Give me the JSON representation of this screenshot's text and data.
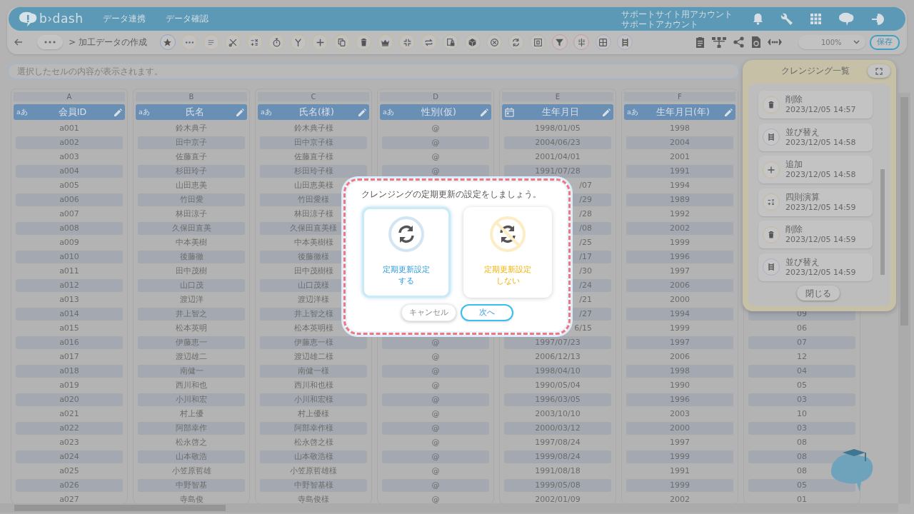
{
  "header": {
    "logo": "b›dash",
    "nav": [
      {
        "label": "データ連携"
      },
      {
        "label": "データ確認"
      }
    ],
    "account": [
      "サポートサイト用アカウント",
      "サポートアカウント"
    ]
  },
  "toolbar": {
    "breadcrumb": "> 加工データの作成",
    "tools": [
      {
        "kind": "star",
        "color": "#8ea6bd"
      },
      {
        "kind": "dots",
        "color": "#c6bb95"
      },
      {
        "kind": "lines",
        "color": "#c6bb95"
      },
      {
        "kind": "scissors",
        "color": "#c6bb95"
      },
      {
        "kind": "math",
        "color": "#c6bb95"
      },
      {
        "kind": "stopwatch",
        "color": "#c6bb95"
      },
      {
        "kind": "branch",
        "color": "#c6bb95"
      },
      {
        "kind": "plus",
        "color": "#c6bb95"
      },
      {
        "kind": "copy",
        "color": "#c6bb95"
      },
      {
        "kind": "trash",
        "color": "#c6bb95"
      },
      {
        "kind": "crown",
        "color": "#c6bb95"
      },
      {
        "kind": "compress",
        "color": "#c6bb95"
      },
      {
        "kind": "swap",
        "color": "#c6bb95"
      },
      {
        "kind": "lock",
        "color": "#b3bc9f"
      },
      {
        "kind": "cube",
        "color": "#b3bc9f"
      },
      {
        "kind": "close",
        "color": "#b3bc9f"
      },
      {
        "kind": "cycle",
        "color": "#b3bc9f"
      },
      {
        "kind": "square",
        "color": "#b3bc9f"
      },
      {
        "kind": "filter",
        "color": "#c99c9c"
      },
      {
        "kind": "split",
        "color": "#c99c9c"
      },
      {
        "kind": "table",
        "color": "#b4a9c6"
      },
      {
        "kind": "ladder",
        "color": "#b4a9c6"
      }
    ],
    "zoom": "100%",
    "save": "保存"
  },
  "cell_bar": {
    "placeholder": "選択したセルの内容が表示されます。"
  },
  "table": {
    "columns": [
      {
        "letter": "A",
        "name": "会員ID",
        "kind": "text",
        "type_label": "aあ"
      },
      {
        "letter": "B",
        "name": "氏名",
        "kind": "text",
        "type_label": "aあ"
      },
      {
        "letter": "C",
        "name": "氏名(様)",
        "kind": "text",
        "type_label": "aあ"
      },
      {
        "letter": "D",
        "name": "性別(仮)",
        "kind": "text",
        "type_label": "aあ"
      },
      {
        "letter": "E",
        "name": "生年月日",
        "kind": "date"
      },
      {
        "letter": "F",
        "name": "生年月日(年)",
        "kind": "text",
        "type_label": "aあ"
      },
      {
        "kind": "covered"
      }
    ],
    "rows": [
      [
        "a001",
        "鈴木典子",
        "鈴木典子様",
        "@",
        "1998/01/05",
        "1998",
        null
      ],
      [
        "a002",
        "田中京子",
        "田中京子様",
        "@",
        "2004/06/23",
        "2004",
        null
      ],
      [
        "a003",
        "佐藤直子",
        "佐藤直子様",
        "@",
        "2001/04/01",
        "2001",
        null
      ],
      [
        "a004",
        "杉田玲子",
        "杉田玲子様",
        "@",
        "1991/07/28",
        "1991",
        null
      ],
      [
        "a005",
        "山田恵美",
        "山田恵美様",
        null,
        {
          "text": "/07",
          "covered": true
        },
        "1994",
        null
      ],
      [
        "a006",
        "竹田愛",
        "竹田愛様",
        null,
        {
          "text": "/29",
          "covered": true
        },
        "1989",
        null
      ],
      [
        "a007",
        "林田涼子",
        "林田涼子様",
        null,
        {
          "text": "/28",
          "covered": true
        },
        "1992",
        null
      ],
      [
        "a008",
        "久保田直美",
        "久保田直美様",
        null,
        {
          "text": "/08",
          "covered": true
        },
        "2002",
        null
      ],
      [
        "a009",
        "中本美樹",
        "中本美樹様",
        null,
        {
          "text": "/25",
          "covered": true
        },
        "1999",
        null
      ],
      [
        "a010",
        "後藤徹",
        "後藤徹様",
        null,
        {
          "text": "/17",
          "covered": true
        },
        "1996",
        null
      ],
      [
        "a011",
        "田中茂樹",
        "田中茂樹様",
        null,
        {
          "text": "/30",
          "covered": true
        },
        "1997",
        null
      ],
      [
        "a012",
        "山口茂",
        "山口茂様",
        null,
        {
          "text": "/24",
          "covered": true
        },
        "2006",
        null
      ],
      [
        "a013",
        "渡辺洋",
        "渡辺洋様",
        null,
        {
          "text": "/21",
          "covered": true
        },
        "2000",
        null
      ],
      [
        "a014",
        "井上智之",
        "井上智之様",
        null,
        {
          "text": "/27",
          "covered": true
        },
        "1994",
        "09"
      ],
      [
        "a015",
        "松本英明",
        "松本英明様",
        null,
        {
          "text": "6/15",
          "covered": true
        },
        "1999",
        "06"
      ],
      [
        "a016",
        "伊藤恵一",
        "伊藤恵一様",
        "@",
        "1997/07/23",
        "1997",
        "07"
      ],
      [
        "a017",
        "渡辺雄二",
        "渡辺雄二様",
        "@",
        "2006/12/13",
        "2006",
        "12"
      ],
      [
        "a018",
        "南健一",
        "南健一様",
        "@",
        "1998/04/10",
        "1998",
        "04"
      ],
      [
        "a019",
        "西川和也",
        "西川和也様",
        "@",
        "1990/05/04",
        "1990",
        "05"
      ],
      [
        "a020",
        "小川和宏",
        "小川和宏様",
        "@",
        "1996/03/05",
        "1996",
        "03"
      ],
      [
        "a021",
        "村上優",
        "村上優様",
        "@",
        "2003/10/10",
        "2003",
        "10"
      ],
      [
        "a022",
        "阿部幸作",
        "阿部幸作様",
        "@",
        "2000/03/12",
        "2000",
        "03"
      ],
      [
        "a023",
        "松永啓之",
        "松永啓之様",
        "@",
        "1997/08/24",
        "1997",
        "08"
      ],
      [
        "a024",
        "山本敬浩",
        "山本敬浩様",
        "@",
        "1999/08/24",
        "1999",
        "08"
      ],
      [
        "a025",
        "小笠原哲雄",
        "小笠原哲雄様",
        "@",
        "1991/08/18",
        "1991",
        "08"
      ],
      [
        "a026",
        "中野智基",
        "中野智基様",
        "@",
        "1999/05/08",
        "1999",
        "05"
      ],
      [
        "a027",
        "寺島俊",
        "寺島俊様",
        "@",
        "2002/01/09",
        "2002",
        "01"
      ]
    ]
  },
  "panel": {
    "title": "クレンジング一覧",
    "items": [
      {
        "kind": "trash",
        "color": "#c6bb95",
        "label": "削除",
        "time": "2023/12/05 14:57"
      },
      {
        "kind": "ladder",
        "color": "#b4a9c6",
        "label": "並び替え",
        "time": "2023/12/05 14:58"
      },
      {
        "kind": "plus",
        "color": "#c6bb95",
        "label": "追加",
        "time": "2023/12/05 14:58"
      },
      {
        "kind": "math",
        "color": "#c6bb95",
        "label": "四則演算",
        "time": "2023/12/05 14:59"
      },
      {
        "kind": "trash",
        "color": "#c6bb95",
        "label": "削除",
        "time": "2023/12/05 14:59"
      },
      {
        "kind": "ladder",
        "color": "#b4a9c6",
        "label": "並び替え",
        "time": "2023/12/05 14:59"
      }
    ],
    "close": "閉じる"
  },
  "dialog": {
    "message": "クレンジングの定期更新の設定をしましょう。",
    "options": [
      {
        "kind": "on",
        "label": [
          "定期更新設定",
          "する"
        ],
        "selected": true
      },
      {
        "kind": "off",
        "label": [
          "定期更新設定",
          "しない"
        ],
        "selected": false
      }
    ],
    "buttons": [
      {
        "kind": "secondary",
        "label": "キャンセル"
      },
      {
        "kind": "primary",
        "label": "次へ"
      }
    ]
  }
}
